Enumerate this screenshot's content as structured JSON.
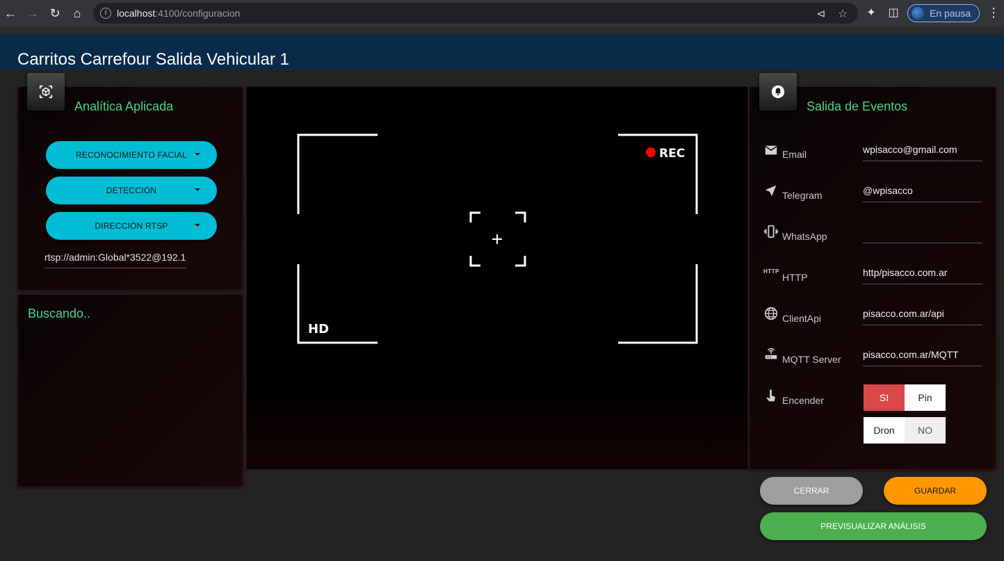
{
  "browser": {
    "url_host": "localhost",
    "url_path": ":4100/configuracion",
    "profile_label": "En pausa"
  },
  "app": {
    "title": "Carritos Carrefour Salida Vehicular 1"
  },
  "analytics": {
    "title": "Analítica Aplicada",
    "buttons": [
      "RECONOCIMIENTO FACIAL",
      "DETECCION",
      "DIRECCIÓN RTSP"
    ],
    "rtsp_value": "rtsp://admin:Global*3522@192.1"
  },
  "search": {
    "status": "Buscando.."
  },
  "video": {
    "rec_label": "REC",
    "hd_label": "HD",
    "rec_color": "#ff0000"
  },
  "events": {
    "title": "Salida de Eventos",
    "rows": [
      {
        "label": "Email",
        "value": "wpisacco@gmail.com",
        "icon": "email-icon"
      },
      {
        "label": "Telegram",
        "value": "@wpisacco",
        "icon": "send-icon"
      },
      {
        "label": "WhatsApp",
        "value": "",
        "icon": "phone-vibrate-icon"
      },
      {
        "label": "HTTP",
        "value": "http/pisacco.com.ar",
        "icon": "http-icon"
      },
      {
        "label": "ClientApi",
        "value": "pisacco.com.ar/api",
        "icon": "globe-icon"
      },
      {
        "label": "MQTT Server",
        "value": "pisacco.com.ar/MQTT",
        "icon": "router-icon"
      }
    ],
    "encender_label": "Encender",
    "toggles_row1": [
      "SI",
      "Pin"
    ],
    "toggles_row2": [
      "Dron",
      "NO"
    ]
  },
  "actions": {
    "close": "CERRAR",
    "save": "GUARDAR",
    "preview": "PREVISUALIZAR ANÁLISIS"
  },
  "colors": {
    "accent_cyan": "#00bcd4",
    "title_green": "#4cd08a",
    "header_blue": "#0a2a4a",
    "save_orange": "#ff9800",
    "preview_green": "#4caf50",
    "active_red": "#d84848"
  }
}
